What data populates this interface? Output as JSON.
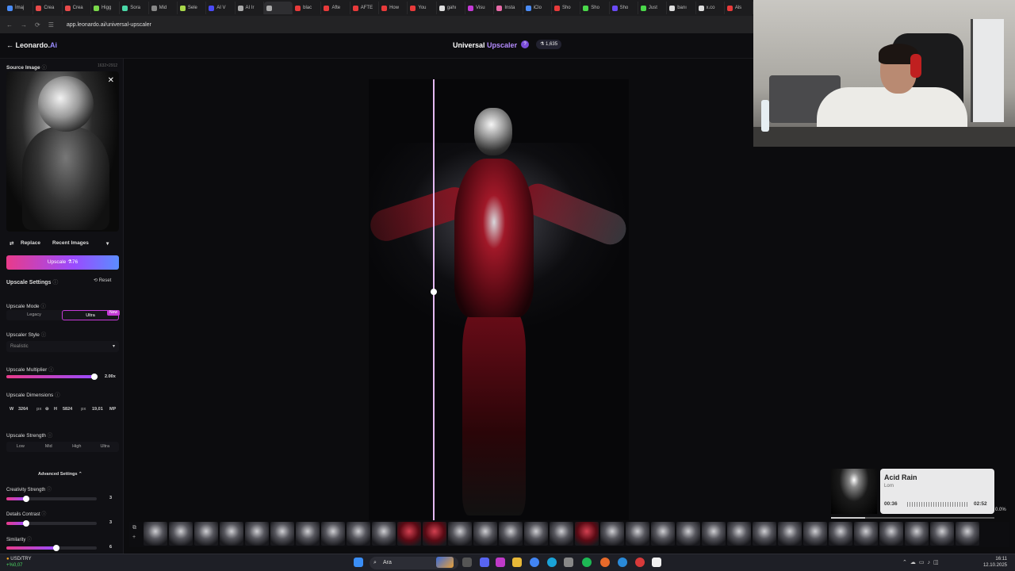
{
  "browser": {
    "tabs": [
      "İmaj",
      "Crea",
      "Crea",
      "Higg",
      "Sora",
      "Mid",
      "Sele",
      "AI V",
      "AI Ir",
      "",
      "blac",
      "Afte",
      "AFTE",
      "How",
      "You",
      "gahı",
      "Visu",
      "Insta",
      "iClo",
      "Sho",
      "Sho",
      "Sho",
      "Just",
      "banı",
      "x.co",
      "Als"
    ],
    "url": "app.leonardo.ai/universal-upscaler"
  },
  "header": {
    "logo_main": "Leonardo.",
    "logo_ai": "Ai",
    "title_main": "Universal",
    "title_accent": "Upscaler",
    "help": "?",
    "tokens": "1,635"
  },
  "sidebar": {
    "source_label": "Source Image",
    "source_dims": "1632×2912",
    "replace": "Replace",
    "recent": "Recent Images",
    "upscale_btn": "Upscale  ⚗76",
    "settings_label": "Upscale Settings",
    "reset": "Reset",
    "mode_label": "Upscale Mode",
    "modes": [
      "Legacy",
      "Ultra"
    ],
    "mode_selected": "Ultra",
    "new_badge": "New",
    "style_label": "Upscaler Style",
    "style_value": "Realistic",
    "multiplier_label": "Upscale Multiplier",
    "multiplier_value": "2.00x",
    "multiplier_fraction": 0.96,
    "dims_label": "Upscale Dimensions",
    "dims": {
      "w_label": "W",
      "w": "3264",
      "px1": "px",
      "h_label": "H",
      "h": "5824",
      "px2": "px",
      "mp": "19,01",
      "mp_unit": "MP"
    },
    "strength_label": "Upscale Strength",
    "strengths": [
      "Low",
      "Mid",
      "High",
      "Ultra"
    ],
    "advanced": "Advanced Settings",
    "creativity_label": "Creativity Strength",
    "creativity_value": "3",
    "creativity_fraction": 0.22,
    "details_label": "Details Contrast",
    "details_value": "3",
    "details_fraction": 0.22,
    "similarity_label": "Similarity",
    "similarity_value": "6",
    "similarity_fraction": 0.55
  },
  "music": {
    "title": "Acid Rain",
    "artist": "Lorn",
    "elapsed": "00:36",
    "total": "02:52",
    "progress": 0.21
  },
  "percent": "0.0%",
  "taskbar": {
    "usd_label": "USD/TRY",
    "usd_change": "+%0,07",
    "search": "Ara",
    "time": "16:11",
    "date": "12.10.2025"
  },
  "colors": {
    "accent": "#9a4bff",
    "pink": "#e83b8a",
    "blue": "#5b8dff"
  }
}
